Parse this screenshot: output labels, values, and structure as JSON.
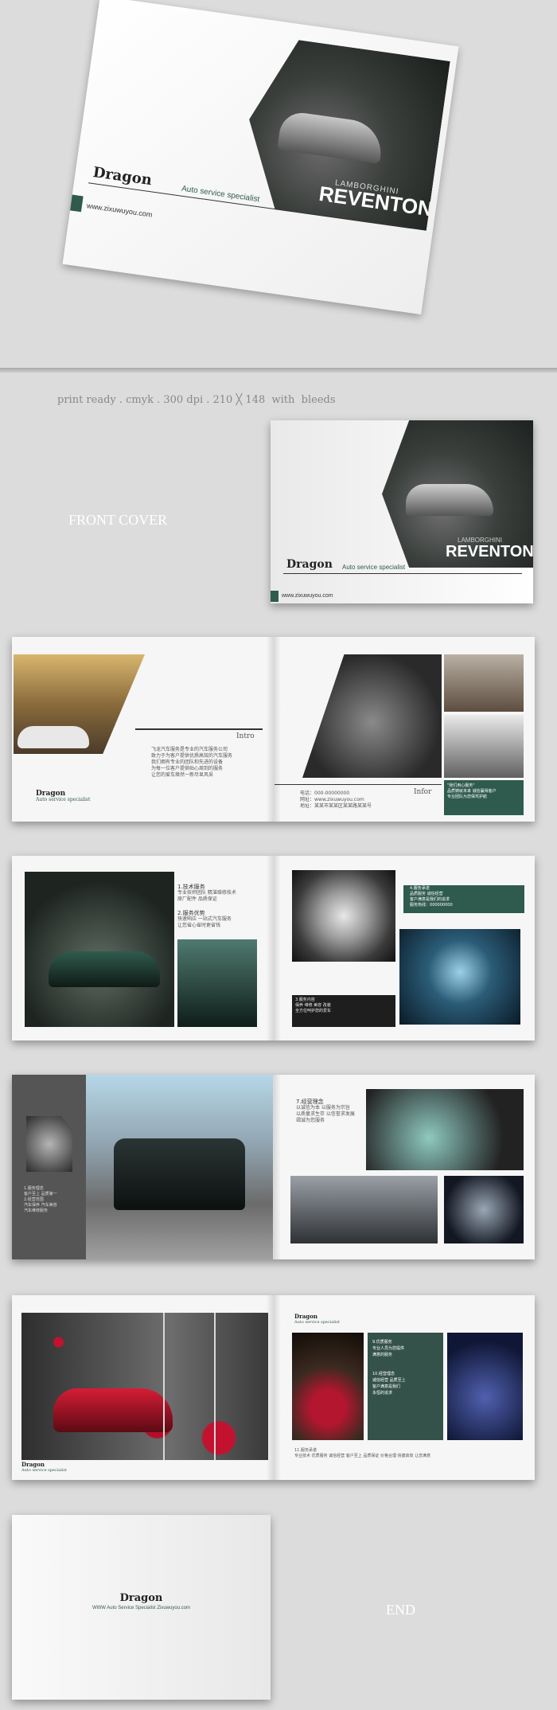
{
  "top_cover": {
    "brand": "Dragon",
    "tagline": "Auto service specialist",
    "url": "www.zixuwuyou.com",
    "model_small": "LAMBORGHINI",
    "model": "REVENTON"
  },
  "specs_line": "print ready . cmyk . 300 dpi . 210 ╳ 148  with  bleeds",
  "front_cover_label": "FRONT COVER",
  "front_cover": {
    "brand": "Dragon",
    "tagline": "Auto service specialist",
    "url": "www.zixuwuyou.com",
    "model_small": "LAMBORGHINI",
    "model": "REVENTON"
  },
  "spread1": {
    "brand": "Dragon",
    "tagline": "Auto service specialist",
    "intro_heading": "Intro",
    "intro_lines": [
      "飞龙汽车服务是专业的汽车服务公司",
      "致力于为客户提供优质高效的汽车服务",
      "我们拥有专业的团队和先进的设备",
      "为每一位客户提供贴心周到的服务",
      "让您的爱车焕然一新尽显风采"
    ],
    "info_heading": "Infor",
    "contact_lines": [
      "电话：000-00000000",
      "网址：www.zixuwuyou.com",
      "地址：某某市某某区某某路某某号"
    ],
    "green_box_lines": [
      "\"我们用心服务\"",
      "品质铸就未来 诚信赢得客户",
      "专业团队为您保驾护航"
    ]
  },
  "spread2": {
    "item1_title": "1.技术服务",
    "item1_lines": [
      "专业技师团队 精湛维修技术",
      "原厂配件 品质保证"
    ],
    "item2_title": "2.服务优势",
    "item2_lines": [
      "快速响应 一站式汽车服务",
      "让您省心省时更省钱"
    ],
    "item3_title": "3.服务内容",
    "item3_lines": [
      "保养 维修 美容 改装",
      "全方位呵护您的爱车"
    ],
    "green_title": "4.服务承诺",
    "green_lines": [
      "品质服务 诚信经营",
      "客户满意是我们的追求",
      "服务热线："
    ],
    "green_value": "000000000"
  },
  "spread3": {
    "left_item1_title": "1.服务理念",
    "left_item1_lines": [
      "客户至上 品质第一"
    ],
    "left_item2_title": "2.经营范围",
    "left_item2_lines": [
      "汽车保养 汽车美容",
      "汽车维修服务"
    ],
    "right_item_title": "7.经营理念",
    "right_item_lines": [
      "以诚信为本 以服务为宗旨",
      "以质量求生存 以信誉求发展",
      "竭诚为您服务"
    ]
  },
  "spread4": {
    "left_brand": "Dragon",
    "left_tagline": "Auto service specialist",
    "right_brand": "Dragon",
    "right_tagline": "Auto service specialist",
    "green_item1_title": "9.优质服务",
    "green_item1_lines": [
      "专业人员为您提供",
      "满意的服务"
    ],
    "green_item2_title": "10.经营理念",
    "green_item2_lines": [
      "诚信经营 品质至上",
      "客户满意是我们",
      "永恒的追求"
    ],
    "bottom_title": "11.服务承诺",
    "bottom_line": "专业技术 优质服务 诚信经营 客户至上 品质保证 价格合理 快捷高效 让您满意"
  },
  "back_cover": {
    "brand": "Dragon",
    "line": "WWW Auto Service Specialist Zixuwuyou.com"
  },
  "end_label": "END",
  "colors": {
    "background": "#dcdcdc",
    "accent_green": "#2f5b4e",
    "dark_gray": "#555555"
  }
}
